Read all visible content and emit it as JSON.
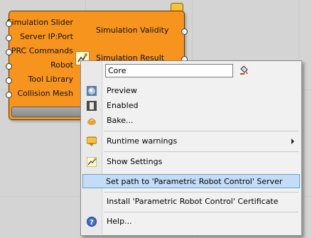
{
  "component": {
    "inputs": [
      "Simulation Slider",
      "Server IP:Port",
      "PRC Commands",
      "Robot",
      "Tool Library",
      "Collision Mesh"
    ],
    "outputs": [
      "Simulation Validity",
      "Simulation Result"
    ],
    "color": "#f7941d"
  },
  "menu": {
    "name_field_value": "Core",
    "items": {
      "preview": "Preview",
      "enabled": "Enabled",
      "bake": "Bake...",
      "runtime_warnings": "Runtime warnings",
      "show_settings": "Show Settings",
      "set_path": "Set path to 'Parametric Robot Control' Server",
      "install_certificate": "Install 'Parametric Robot Control' Certificate",
      "help": "Help..."
    },
    "highlight_color": "#c4dcf5"
  }
}
